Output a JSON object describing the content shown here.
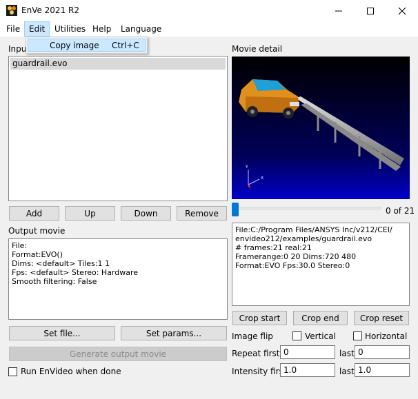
{
  "window": {
    "title": "EnVe 2021 R2"
  },
  "menubar": {
    "items": [
      {
        "id": "file",
        "label": "File"
      },
      {
        "id": "edit",
        "label": "Edit"
      },
      {
        "id": "utilities",
        "label": "Utilities"
      },
      {
        "id": "help",
        "label": "Help"
      },
      {
        "id": "language",
        "label": "Language"
      }
    ],
    "edit_menu": {
      "label": "Copy image",
      "shortcut": "Ctrl+C"
    }
  },
  "input": {
    "label": "Input",
    "files": [
      "guardrail.evo"
    ],
    "buttons": {
      "add": "Add",
      "up": "Up",
      "down": "Down",
      "remove": "Remove"
    }
  },
  "output": {
    "label": "Output movie",
    "info": "File:\nFormat:EVO()\nDims: <default> Tiles:1 1\nFps: <default> Stereo: Hardware\nSmooth filtering: False",
    "set_file": "Set file...",
    "set_params": "Set params...",
    "generate": "Generate output movie",
    "run_label": "Run EnVideo when done",
    "run_checked": false
  },
  "movie": {
    "label": "Movie detail",
    "frame_counter": "0 of 21",
    "frame_progress": 0,
    "info": "File:C:/Program Files/ANSYS Inc/v212/CEI/\nenvideo212/examples/guardrail.evo\n# frames:21 real:21\nFramerange:0 20 Dims:720 480\nFormat:EVO Fps:30.0 Stereo:0",
    "crop_start": "Crop start",
    "crop_end": "Crop end",
    "crop_reset": "Crop reset",
    "image_flip_label": "Image flip",
    "vertical_label": "Vertical",
    "horizontal_label": "Horizontal",
    "repeat_first_label": "Repeat first",
    "repeat_first": "0",
    "repeat_last_label": "last",
    "repeat_last": "0",
    "intensity_first_label": "Intensity first",
    "intensity_first": "1.0",
    "intensity_last_label": "last",
    "intensity_last": "1.0"
  },
  "axes": {
    "y": "Y",
    "x": "X"
  }
}
